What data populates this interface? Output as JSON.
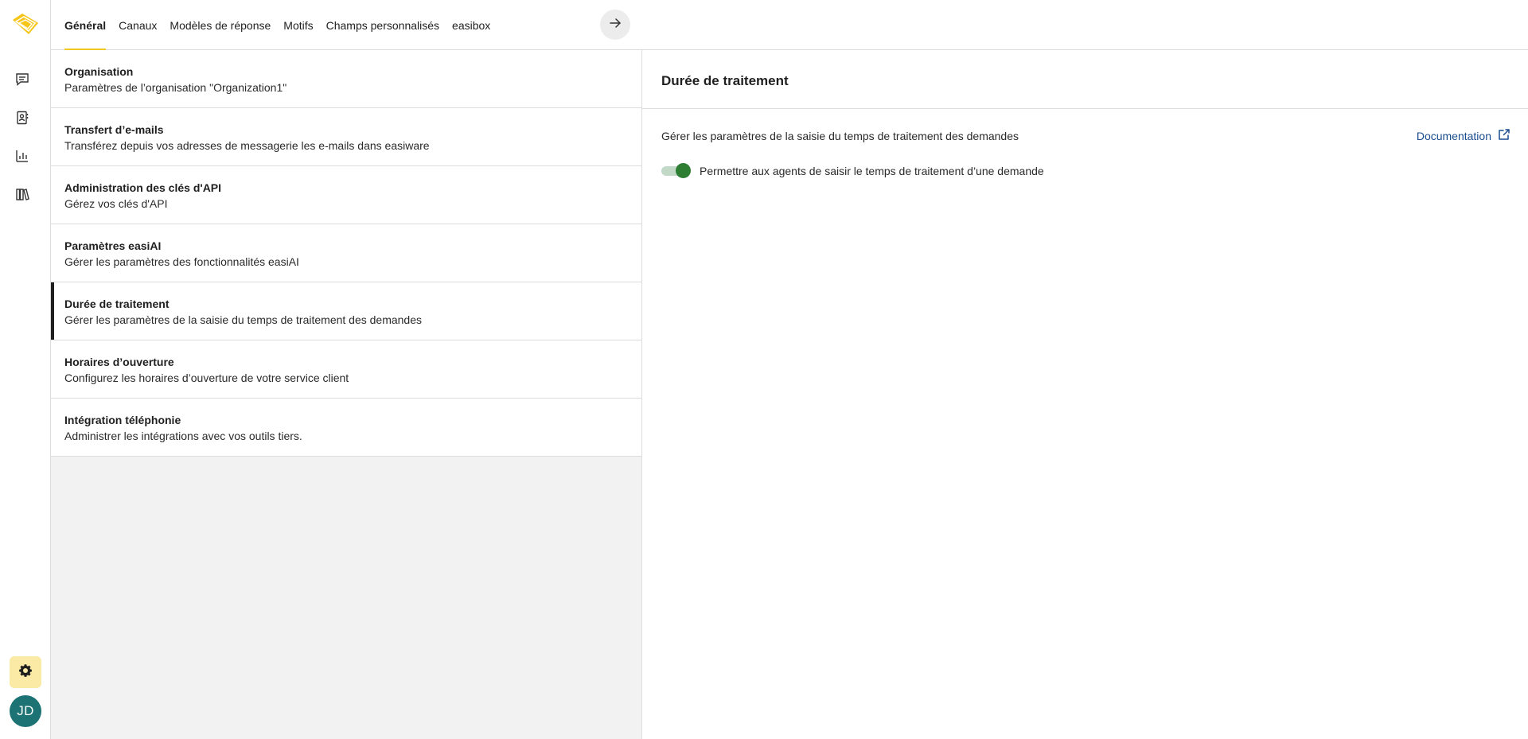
{
  "rail": {
    "icons": [
      "logo-icon",
      "chat-icon",
      "contacts-icon",
      "chart-icon",
      "library-icon",
      "gear-icon"
    ],
    "avatar_initials": "JD"
  },
  "tabs": [
    {
      "label": "Général",
      "active": true
    },
    {
      "label": "Canaux"
    },
    {
      "label": "Modèles de réponse"
    },
    {
      "label": "Motifs"
    },
    {
      "label": "Champs personnalisés"
    },
    {
      "label": "easibox"
    }
  ],
  "settings_list": [
    {
      "title": "Organisation",
      "desc": "Paramètres de l’organisation \"Organization1\""
    },
    {
      "title": "Transfert d’e-mails",
      "desc": "Transférez depuis vos adresses de messagerie les e-mails dans easiware"
    },
    {
      "title": "Administration des clés d'API",
      "desc": "Gérez vos clés d'API"
    },
    {
      "title": "Paramètres easiAI",
      "desc": "Gérer les paramètres des fonctionnalités easiAI"
    },
    {
      "title": "Durée de traitement",
      "desc": "Gérer les paramètres de la saisie du temps de traitement des demandes",
      "active": true
    },
    {
      "title": "Horaires d’ouverture",
      "desc": "Configurez les horaires d’ouverture de votre service client"
    },
    {
      "title": "Intégration téléphonie",
      "desc": "Administrer les intégrations avec vos outils tiers."
    }
  ],
  "detail": {
    "title": "Durée de traitement",
    "description": "Gérer les paramètres de la saisie du temps de traitement des demandes",
    "doc_link": "Documentation",
    "toggle_label": "Permettre aux agents de saisir le temps de traitement d’une demande",
    "toggle_on": true
  },
  "colors": {
    "accent_yellow": "#f2c81d",
    "avatar_teal": "#1d7274",
    "toggle_green": "#2d7d32",
    "link_blue": "#1a4d8f"
  }
}
